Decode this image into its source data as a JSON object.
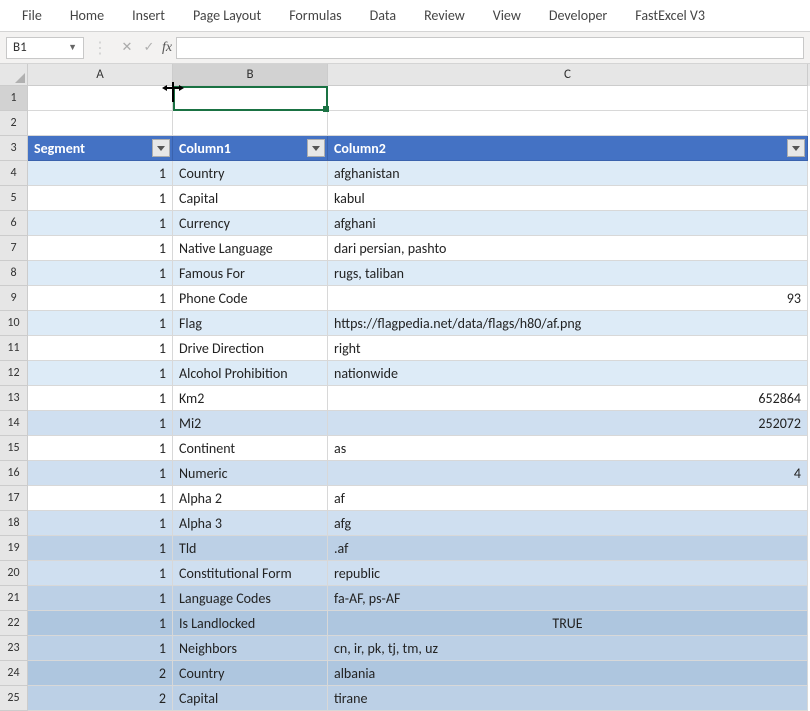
{
  "ribbon": {
    "tabs": [
      "File",
      "Home",
      "Insert",
      "Page Layout",
      "Formulas",
      "Data",
      "Review",
      "View",
      "Developer",
      "FastExcel V3"
    ]
  },
  "namebox": {
    "value": "B1"
  },
  "formula_bar": {
    "fx_label": "fx",
    "value": ""
  },
  "col_headers": [
    "A",
    "B",
    "C"
  ],
  "table": {
    "headers": [
      "Segment",
      "Column1",
      "Column2"
    ],
    "rows": [
      {
        "seg": "1",
        "c1": "Country",
        "c2": "afghanistan",
        "band": "band0"
      },
      {
        "seg": "1",
        "c1": "Capital",
        "c2": "kabul",
        "band": "band1"
      },
      {
        "seg": "1",
        "c1": "Currency",
        "c2": "afghani",
        "band": "band0"
      },
      {
        "seg": "1",
        "c1": "Native Language",
        "c2": "dari persian, pashto",
        "band": "band1"
      },
      {
        "seg": "1",
        "c1": "Famous For",
        "c2": "rugs, taliban",
        "band": "band0"
      },
      {
        "seg": "1",
        "c1": "Phone Code",
        "c2": "93",
        "band": "band1",
        "num": true
      },
      {
        "seg": "1",
        "c1": "Flag",
        "c2": "https://flagpedia.net/data/flags/h80/af.png",
        "band": "band0"
      },
      {
        "seg": "1",
        "c1": "Drive Direction",
        "c2": "right",
        "band": "band1"
      },
      {
        "seg": "1",
        "c1": "Alcohol Prohibition",
        "c2": "nationwide",
        "band": "band0"
      },
      {
        "seg": "1",
        "c1": "Km2",
        "c2": "652864",
        "band": "band1",
        "num": true
      },
      {
        "seg": "1",
        "c1": "Mi2",
        "c2": "252072",
        "band": "band2",
        "num": true
      },
      {
        "seg": "1",
        "c1": "Continent",
        "c2": "as",
        "band": "band1"
      },
      {
        "seg": "1",
        "c1": "Numeric",
        "c2": "4",
        "band": "band2",
        "num": true
      },
      {
        "seg": "1",
        "c1": "Alpha 2",
        "c2": "af",
        "band": "band1"
      },
      {
        "seg": "1",
        "c1": "Alpha 3",
        "c2": "afg",
        "band": "band2"
      },
      {
        "seg": "1",
        "c1": "Tld",
        "c2": ".af",
        "band": "band3"
      },
      {
        "seg": "1",
        "c1": "Constitutional Form",
        "c2": "republic",
        "band": "band2"
      },
      {
        "seg": "1",
        "c1": "Language Codes",
        "c2": "fa-AF, ps-AF",
        "band": "band3"
      },
      {
        "seg": "1",
        "c1": "Is Landlocked",
        "c2": "TRUE",
        "band": "band4",
        "ctr": true
      },
      {
        "seg": "1",
        "c1": "Neighbors",
        "c2": "cn, ir, pk, tj, tm, uz",
        "band": "band3"
      },
      {
        "seg": "2",
        "c1": "Country",
        "c2": "albania",
        "band": "band4"
      },
      {
        "seg": "2",
        "c1": "Capital",
        "c2": "tirane",
        "band": "band3"
      }
    ]
  }
}
